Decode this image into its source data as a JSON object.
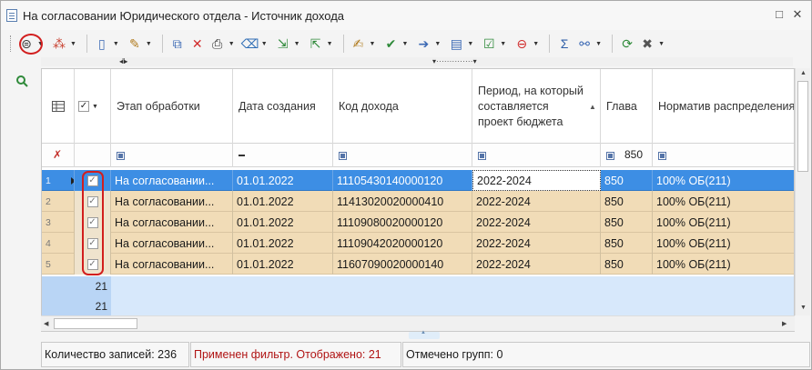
{
  "window": {
    "title": "На согласовании Юридического отдела - Источник дохода",
    "controls": [
      "□",
      "✕"
    ]
  },
  "toolbar": {
    "icons": [
      {
        "name": "filter-toggle-icon",
        "glyph": "⊜",
        "color": "#3a3a3a",
        "dropdown": true
      },
      {
        "name": "multi-select-icon",
        "glyph": "⁂",
        "color": "#c8402f",
        "dropdown": true
      },
      {
        "sep": true
      },
      {
        "name": "new-document-icon",
        "glyph": "▯",
        "color": "#3b69b4",
        "dropdown": true
      },
      {
        "name": "edit-document-icon",
        "glyph": "✎",
        "color": "#b07b1e",
        "dropdown": true
      },
      {
        "sep": true
      },
      {
        "name": "copy-icon",
        "glyph": "⧉",
        "color": "#3b69b4",
        "dropdown": false
      },
      {
        "name": "delete-icon",
        "glyph": "✕",
        "color": "#d12b2b",
        "dropdown": false
      },
      {
        "name": "print-icon",
        "glyph": "⎙",
        "color": "#333333",
        "dropdown": true
      },
      {
        "name": "clear-icon",
        "glyph": "⌫",
        "color": "#2f6db5",
        "dropdown": true
      },
      {
        "name": "import-icon",
        "glyph": "⇲",
        "color": "#2f8a3a",
        "dropdown": true
      },
      {
        "name": "export-icon",
        "glyph": "⇱",
        "color": "#2f8a3a",
        "dropdown": true
      },
      {
        "sep": true
      },
      {
        "name": "document-edit-icon",
        "glyph": "✍",
        "color": "#b07b1e",
        "dropdown": true
      },
      {
        "name": "approve-icon",
        "glyph": "✔",
        "color": "#2f8a3a",
        "dropdown": true
      },
      {
        "name": "document-send-icon",
        "glyph": "➔",
        "color": "#3b69b4",
        "dropdown": true
      },
      {
        "name": "archive-icon",
        "glyph": "▤",
        "color": "#3b69b4",
        "dropdown": true
      },
      {
        "name": "check-document-icon",
        "glyph": "☑",
        "color": "#2f8a3a",
        "dropdown": true
      },
      {
        "name": "reject-icon",
        "glyph": "⊖",
        "color": "#d12b2b",
        "dropdown": true
      },
      {
        "sep": true
      },
      {
        "name": "sum-icon",
        "glyph": "Σ",
        "color": "#2f5fa8",
        "dropdown": false
      },
      {
        "name": "link-icon",
        "glyph": "⚯",
        "color": "#3b69b4",
        "dropdown": true
      },
      {
        "sep": true
      },
      {
        "name": "refresh-icon",
        "glyph": "⟳",
        "color": "#2f8a3a",
        "dropdown": false
      },
      {
        "name": "tools-icon",
        "glyph": "✖",
        "color": "#555555",
        "dropdown": true
      }
    ]
  },
  "grid": {
    "columns": [
      {
        "key": "stage",
        "label": "Этап обработки"
      },
      {
        "key": "date",
        "label": "Дата создания"
      },
      {
        "key": "code",
        "label": "Код дохода"
      },
      {
        "key": "period",
        "label": "Период, на который составляется проект бюджета"
      },
      {
        "key": "chapter",
        "label": "Глава"
      },
      {
        "key": "norm",
        "label": "Норматив распределения"
      }
    ],
    "filters": {
      "chapter": "850"
    },
    "rows": [
      {
        "num": "1",
        "stage": "На согласовании...",
        "date": "01.01.2022",
        "code": "11105430140000120",
        "period": "2022-2024",
        "chapter": "850",
        "norm": "100% ОБ(211)"
      },
      {
        "num": "2",
        "stage": "На согласовании...",
        "date": "01.01.2022",
        "code": "11413020020000410",
        "period": "2022-2024",
        "chapter": "850",
        "norm": "100% ОБ(211)"
      },
      {
        "num": "3",
        "stage": "На согласовании...",
        "date": "01.01.2022",
        "code": "11109080020000120",
        "period": "2022-2024",
        "chapter": "850",
        "norm": "100% ОБ(211)"
      },
      {
        "num": "4",
        "stage": "На согласовании...",
        "date": "01.01.2022",
        "code": "11109042020000120",
        "period": "2022-2024",
        "chapter": "850",
        "norm": "100% ОБ(211)"
      },
      {
        "num": "5",
        "stage": "На согласовании...",
        "date": "01.01.2022",
        "code": "11607090020000140",
        "period": "2022-2024",
        "chapter": "850",
        "norm": "100% ОБ(211)"
      }
    ],
    "group_rows": [
      "21",
      "21"
    ]
  },
  "status": {
    "records": "Количество записей: 236",
    "filter": "Применен фильтр. Отображено: 21",
    "groups": "Отмечено групп: 0"
  },
  "colors": {
    "row_bg": "#f1dcb7",
    "selected_row": "#3d8ee4",
    "highlight": "#d21e1e",
    "group_row": "#cfe3fa"
  }
}
